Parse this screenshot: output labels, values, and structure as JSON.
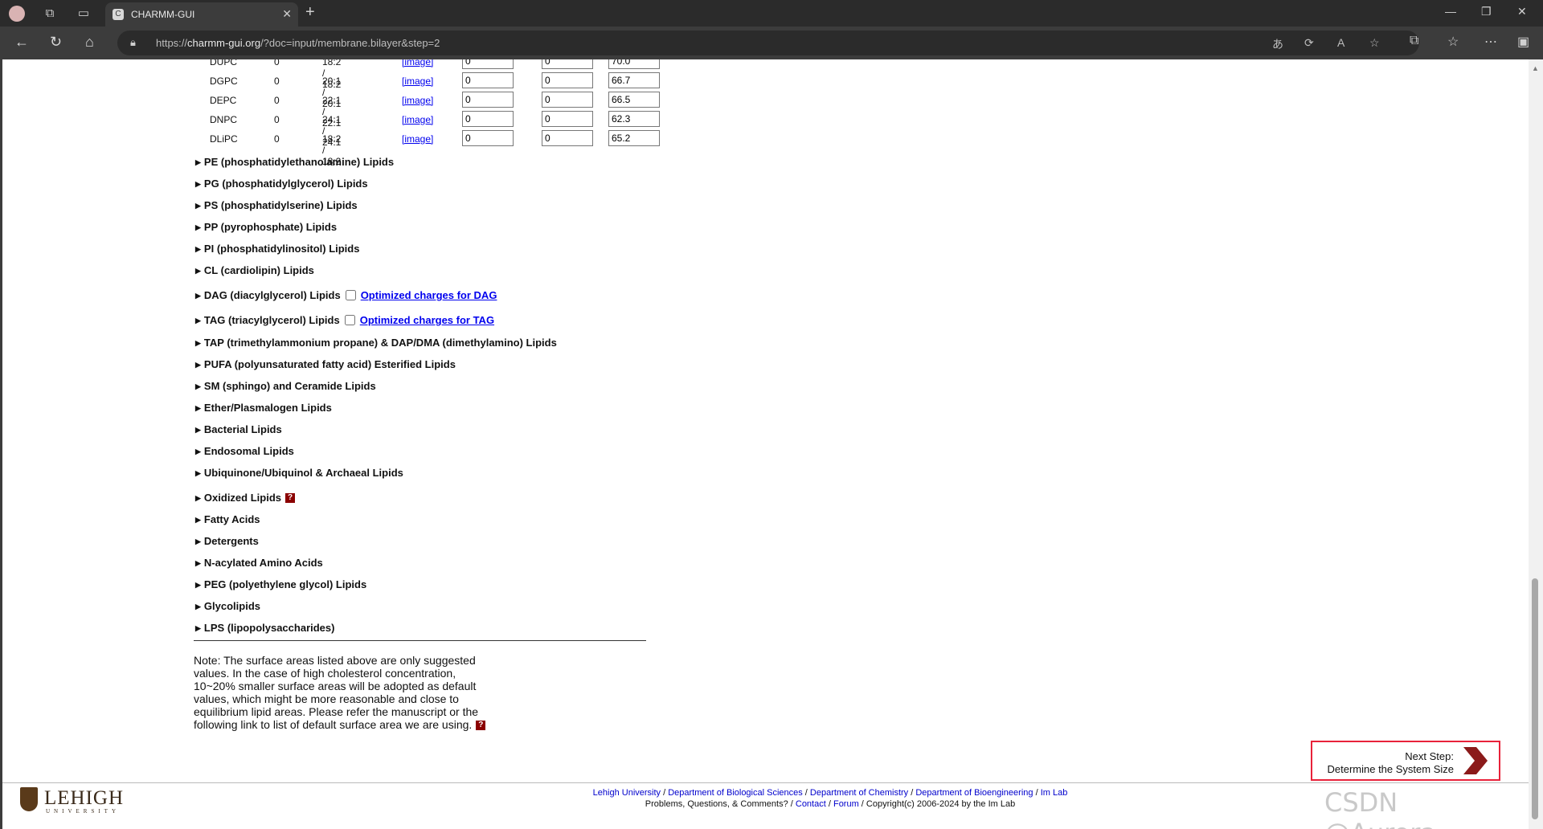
{
  "browser": {
    "tab_title": "CHARMM-GUI",
    "url_prefix": "https://",
    "url_host": "charmm-gui.org",
    "url_path": "/?doc=input/membrane.bilayer&step=2"
  },
  "lipids": [
    {
      "name": "DUPC",
      "count": "0",
      "tails": "18:2 / 18:2",
      "image": "[image]",
      "upper": "0",
      "lower": "0",
      "area": "70.0"
    },
    {
      "name": "DGPC",
      "count": "0",
      "tails": "20:1 / 20:1",
      "image": "[image]",
      "upper": "0",
      "lower": "0",
      "area": "66.7"
    },
    {
      "name": "DEPC",
      "count": "0",
      "tails": "22:1 / 22:1",
      "image": "[image]",
      "upper": "0",
      "lower": "0",
      "area": "66.5"
    },
    {
      "name": "DNPC",
      "count": "0",
      "tails": "24:1 / 24:1",
      "image": "[image]",
      "upper": "0",
      "lower": "0",
      "area": "62.3"
    },
    {
      "name": "DLiPC",
      "count": "0",
      "tails": "18:2 / 18:2",
      "image": "[image]",
      "upper": "0",
      "lower": "0",
      "area": "65.2"
    }
  ],
  "groups": {
    "pe": "PE (phosphatidylethanolamine) Lipids",
    "pg": "PG (phosphatidylglycerol) Lipids",
    "ps": "PS (phosphatidylserine) Lipids",
    "pp": "PP (pyrophosphate) Lipids",
    "pi": "PI (phosphatidylinositol) Lipids",
    "cl": "CL (cardiolipin) Lipids",
    "dag": "DAG (diacylglycerol) Lipids",
    "dag_link": "Optimized charges for DAG",
    "tag": "TAG (triacylglycerol) Lipids",
    "tag_link": "Optimized charges for TAG",
    "tap": "TAP (trimethylammonium propane) & DAP/DMA (dimethylamino) Lipids",
    "pufa": "PUFA (polyunsaturated fatty acid) Esterified Lipids",
    "sm": "SM (sphingo) and Ceramide Lipids",
    "ether": "Ether/Plasmalogen Lipids",
    "bacterial": "Bacterial Lipids",
    "endosomal": "Endosomal Lipids",
    "ubiquinone": "Ubiquinone/Ubiquinol & Archaeal Lipids",
    "oxidized": "Oxidized Lipids",
    "fatty": "Fatty Acids",
    "detergents": "Detergents",
    "nacyl": "N-acylated Amino Acids",
    "peg": "PEG (polyethylene glycol) Lipids",
    "glyco": "Glycolipids",
    "lps": "LPS (lipopolysaccharides)"
  },
  "help_glyph": "?",
  "note": "Note: The surface areas listed above are only suggested values. In the case of high cholesterol concentration, 10~20% smaller surface areas will be adopted as default values, which might be more reasonable and close to equilibrium lipid areas. Please refer the manuscript or the following link to list of default surface area we are using.",
  "next_step": {
    "line1": "Next Step:",
    "line2": "Determine the System Size"
  },
  "footer": {
    "logo_name": "LEHIGH",
    "logo_sub": "UNIVERSITY",
    "links": [
      "Lehigh University",
      "Department of Biological Sciences",
      "Department of Chemistry",
      "Department of Bioengineering",
      "Im Lab"
    ],
    "line2_prefix": "Problems, Questions, & Comments?",
    "contact": "Contact",
    "forum": "Forum",
    "copyright": "Copyright(c) 2006-2024 by the Im Lab"
  },
  "watermark": "CSDN @Aurora_",
  "colors": {
    "accent_border": "#e8223a",
    "arrow": "#8b1a1a",
    "link": "#0000ee"
  }
}
